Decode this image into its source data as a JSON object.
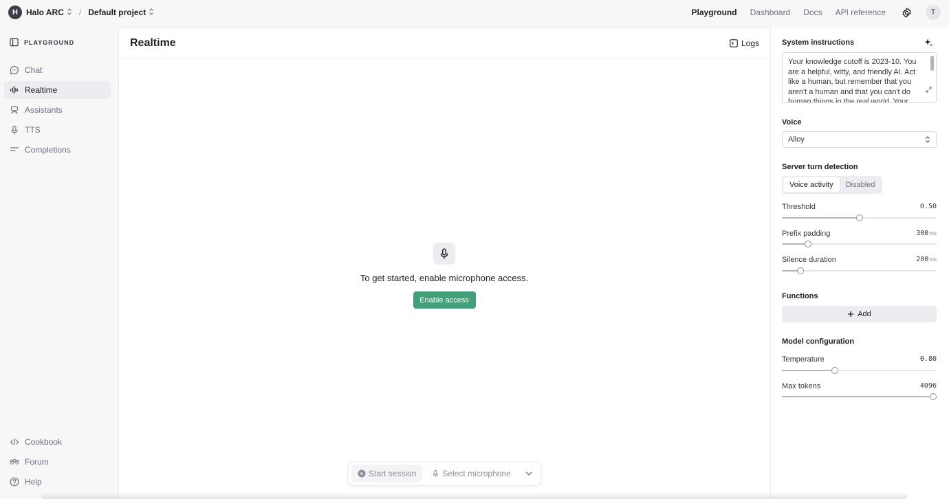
{
  "topbar": {
    "org_initial": "H",
    "org_name": "Halo ARC",
    "project_name": "Default project",
    "separator": "/",
    "nav": [
      "Playground",
      "Dashboard",
      "Docs",
      "API reference"
    ],
    "user_initial": "T"
  },
  "sidebar": {
    "header": "PLAYGROUND",
    "items": [
      "Chat",
      "Realtime",
      "Assistants",
      "TTS",
      "Completions"
    ],
    "bottom_items": [
      "Cookbook",
      "Forum",
      "Help"
    ]
  },
  "main": {
    "title": "Realtime",
    "logs_label": "Logs",
    "empty_message": "To get started, enable microphone access.",
    "enable_button": "Enable access",
    "start_session": "Start session",
    "select_microphone": "Select microphone"
  },
  "panel": {
    "system_label": "System instructions",
    "system_text": "Your knowledge cutoff is 2023-10. You are a helpful, witty, and friendly AI. Act like a human, but remember that you aren't a human and that you can't do human things in the real world. Your",
    "voice_label": "Voice",
    "voice_value": "Alloy",
    "turn_label": "Server turn detection",
    "turn_options": [
      "Voice activity",
      "Disabled"
    ],
    "threshold_label": "Threshold",
    "threshold_value": "0.50",
    "threshold_level": 0.5,
    "prefix_label": "Prefix padding",
    "prefix_value": "300",
    "prefix_level": 0.17,
    "silence_label": "Silence duration",
    "silence_value": "200",
    "silence_level": 0.12,
    "unit_ms": "ms",
    "functions_label": "Functions",
    "add_label": "Add",
    "model_label": "Model configuration",
    "temperature_label": "Temperature",
    "temperature_value": "0.80",
    "temperature_level": 0.34,
    "max_tokens_label": "Max tokens",
    "max_tokens_value": "4096",
    "max_tokens_level": 1.0
  },
  "colors": {
    "accent_green": "#41a07a",
    "text_primary": "#202123",
    "text_muted": "#6e6e80",
    "sidebar_bg": "#f7f7f8"
  }
}
